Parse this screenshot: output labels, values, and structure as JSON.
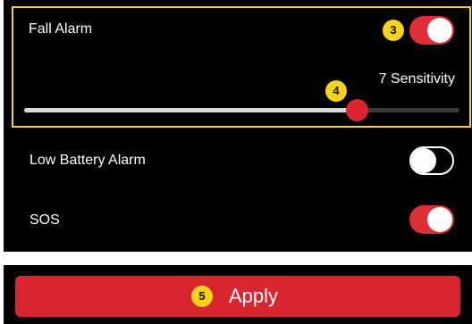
{
  "settings": {
    "fall_alarm": {
      "label": "Fall Alarm",
      "enabled": true,
      "sensitivity_label": "7 Sensitivity",
      "sensitivity_level": 0.764
    },
    "low_battery_alarm": {
      "label": "Low Battery Alarm",
      "enabled": false
    },
    "sos": {
      "label": "SOS",
      "enabled": true
    }
  },
  "callouts": {
    "toggle_step": "3",
    "slider_step": "4",
    "apply_step": "5"
  },
  "apply": {
    "label": "Apply"
  },
  "colors": {
    "accent": "#df2f36",
    "highlight": "#f2d51b",
    "background": "#000000"
  }
}
